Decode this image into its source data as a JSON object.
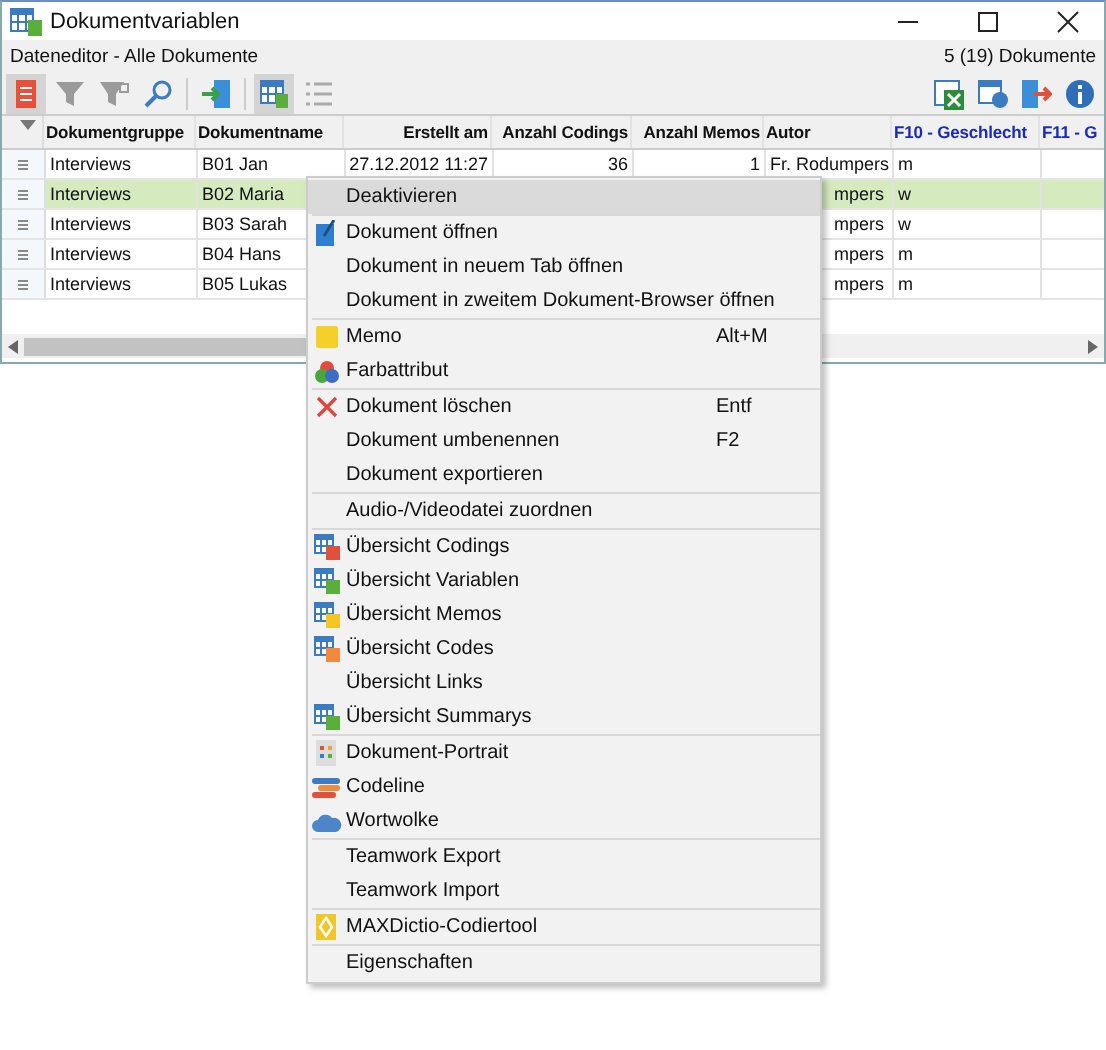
{
  "window": {
    "title": "Dokumentvariablen"
  },
  "subheader": {
    "left": "Dateneditor - Alle Dokumente",
    "right": "5 (19) Dokumente"
  },
  "toolbar_left": [
    {
      "kind": "doc",
      "selected": true
    },
    {
      "kind": "filter",
      "selected": false
    },
    {
      "kind": "filter2",
      "selected": false
    },
    {
      "kind": "search",
      "selected": false
    },
    {
      "kind": "import",
      "selected": false
    },
    {
      "kind": "table",
      "selected": true
    },
    {
      "kind": "list",
      "selected": false
    }
  ],
  "toolbar_right": [
    {
      "kind": "excel"
    },
    {
      "kind": "tableexport"
    },
    {
      "kind": "export"
    },
    {
      "kind": "info"
    }
  ],
  "table": {
    "columns": [
      {
        "label": "Dokumentgruppe",
        "variable": false
      },
      {
        "label": "Dokumentname",
        "variable": false
      },
      {
        "label": "Erstellt am",
        "variable": false
      },
      {
        "label": "Anzahl Codings",
        "variable": false
      },
      {
        "label": "Anzahl Memos",
        "variable": false
      },
      {
        "label": "Autor",
        "variable": false
      },
      {
        "label": "F10 - Geschlecht",
        "variable": true
      },
      {
        "label": "F11 - G",
        "variable": true
      }
    ],
    "rows": [
      {
        "selected": false,
        "cells": [
          "Interviews",
          "B01 Jan",
          "27.12.2012 11:27",
          "36",
          "1",
          "Fr. Rodumpers",
          "m",
          ""
        ]
      },
      {
        "selected": true,
        "cells": [
          "Interviews",
          "B02 Maria",
          "",
          "",
          "",
          "mpers",
          "w",
          ""
        ]
      },
      {
        "selected": false,
        "cells": [
          "Interviews",
          "B03 Sarah",
          "",
          "",
          "",
          "mpers",
          "w",
          ""
        ]
      },
      {
        "selected": false,
        "cells": [
          "Interviews",
          "B04 Hans",
          "",
          "",
          "",
          "mpers",
          "m",
          ""
        ]
      },
      {
        "selected": false,
        "cells": [
          "Interviews",
          "B05 Lukas",
          "",
          "",
          "",
          "mpers",
          "m",
          ""
        ]
      }
    ]
  },
  "context_menu": [
    [
      {
        "label": "Deaktivieren",
        "selected": true
      }
    ],
    [
      {
        "label": "Dokument öffnen",
        "kind": "edit",
        "selected": false
      },
      {
        "label": "Dokument in neuem Tab öffnen",
        "selected": false
      },
      {
        "label": "Dokument in zweitem Dokument-Browser öffnen",
        "selected": false
      }
    ],
    [
      {
        "label": "Memo",
        "kind": "memo",
        "shortcut": "Alt+M",
        "selected": false
      },
      {
        "label": "Farbattribut",
        "kind": "color",
        "selected": false
      }
    ],
    [
      {
        "label": "Dokument löschen",
        "kind": "delete",
        "shortcut": "Entf",
        "selected": false
      },
      {
        "label": "Dokument umbenennen",
        "shortcut": "F2",
        "selected": false
      },
      {
        "label": "Dokument exportieren",
        "selected": false
      }
    ],
    [
      {
        "label": "Audio-/Videodatei zuordnen",
        "selected": false
      }
    ],
    [
      {
        "label": "Übersicht Codings",
        "kind": "tcodings",
        "selected": false
      },
      {
        "label": "Übersicht Variablen",
        "kind": "tvars",
        "selected": false
      },
      {
        "label": "Übersicht Memos",
        "kind": "tmemos",
        "selected": false
      },
      {
        "label": "Übersicht Codes",
        "kind": "tcodes",
        "selected": false
      },
      {
        "label": "Übersicht Links",
        "selected": false
      },
      {
        "label": "Übersicht Summarys",
        "kind": "tsum",
        "selected": false
      }
    ],
    [
      {
        "label": "Dokument-Portrait",
        "kind": "portrait",
        "selected": false
      },
      {
        "label": "Codeline",
        "kind": "codeline",
        "selected": false
      },
      {
        "label": "Wortwolke",
        "kind": "cloud",
        "selected": false
      }
    ],
    [
      {
        "label": "Teamwork Export",
        "selected": false
      },
      {
        "label": "Teamwork Import",
        "selected": false
      }
    ],
    [
      {
        "label": "MAXDictio-Codiertool",
        "kind": "dictio",
        "selected": false
      }
    ],
    [
      {
        "label": "Eigenschaften",
        "selected": false
      }
    ]
  ]
}
